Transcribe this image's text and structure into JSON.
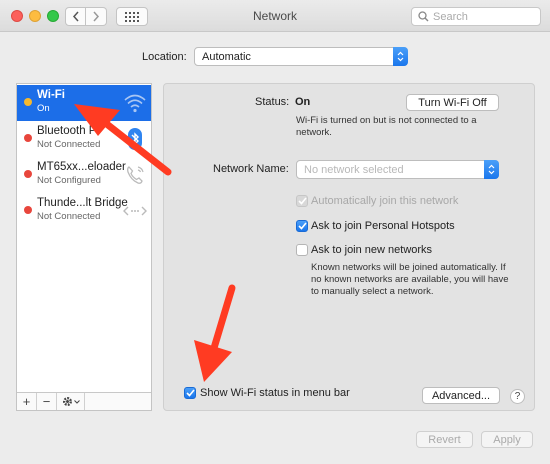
{
  "window": {
    "title": "Network"
  },
  "toolbar": {
    "back_icon": "chevron-left-icon",
    "forward_icon": "chevron-right-icon",
    "grid_icon": "grid-icon",
    "search_placeholder": "Search"
  },
  "location": {
    "label": "Location:",
    "value": "Automatic"
  },
  "services": [
    {
      "name": "Wi-Fi",
      "status": "On",
      "status_color": "#f5b82e",
      "icon": "wifi-icon",
      "selected": true
    },
    {
      "name": "Bluetooth P",
      "status": "Not Connected",
      "status_color": "#e8463c",
      "icon": "bluetooth-icon",
      "selected": false
    },
    {
      "name": "MT65xx...eloader",
      "status": "Not Configured",
      "status_color": "#e8463c",
      "icon": "phone-icon",
      "selected": false
    },
    {
      "name": "Thunde...lt Bridge",
      "status": "Not Connected",
      "status_color": "#e8463c",
      "icon": "thunderbolt-bridge-icon",
      "selected": false
    }
  ],
  "sidebar_actions": {
    "add": "+",
    "remove": "−",
    "gear_icon": "gear-icon"
  },
  "detail": {
    "status_label": "Status:",
    "status_value": "On",
    "turn_off_button": "Turn Wi-Fi Off",
    "status_description": "Wi-Fi is turned on but is not connected to a network.",
    "network_name_label": "Network Name:",
    "network_name_placeholder": "No network selected",
    "auto_join_label": "Automatically join this network",
    "auto_join_checked": true,
    "auto_join_enabled": false,
    "ask_hotspots_label": "Ask to join Personal Hotspots",
    "ask_hotspots_checked": true,
    "ask_new_label": "Ask to join new networks",
    "ask_new_checked": false,
    "ask_new_description": "Known networks will be joined automatically. If no known networks are available, you will have to manually select a network.",
    "show_status_label": "Show Wi-Fi status in menu bar",
    "show_status_checked": true,
    "advanced_button": "Advanced...",
    "help_button": "?"
  },
  "footer": {
    "revert_button": "Revert",
    "apply_button": "Apply"
  },
  "colors": {
    "accent": "#1c6ee8",
    "annotation_arrow": "#ff3b22"
  }
}
